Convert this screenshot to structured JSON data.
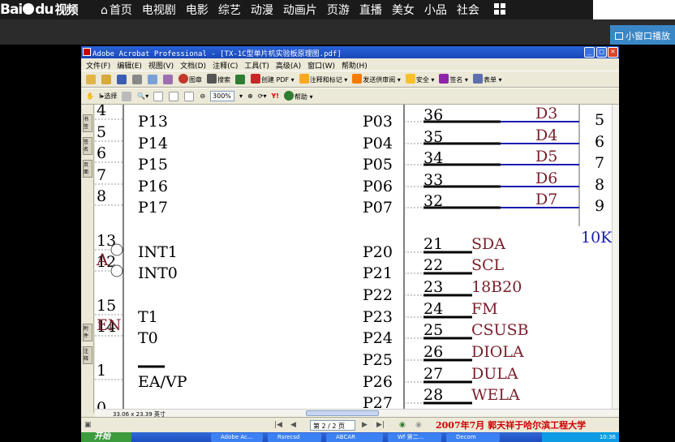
{
  "baidu": {
    "logo_text": "Bai",
    "logo_text2": "du",
    "logo_sub": "视频",
    "nav": [
      "首页",
      "电视剧",
      "电影",
      "综艺",
      "动漫",
      "动画片",
      "页游",
      "直播",
      "美女",
      "小品",
      "社会"
    ],
    "mini_play": "小窗口播放"
  },
  "acrobat": {
    "title": "Adobe Acrobat Professional - [TX-1C型单片机实验板原理图.pdf]",
    "menus": [
      "文件(F)",
      "编辑(E)",
      "视图(V)",
      "文档(D)",
      "注释(C)",
      "工具(T)",
      "高级(A)",
      "窗口(W)",
      "帮助(H)"
    ],
    "toolbar1": [
      "图章",
      "搜索",
      "创建 PDF",
      "注释和标记",
      "发送供审阅",
      "安全",
      "签名",
      "表单"
    ],
    "toolbar2": [
      "选择",
      "300%",
      "帮助"
    ],
    "side_tabs": [
      "书签",
      "签名",
      "页面",
      "附件",
      "注释"
    ],
    "page_size": "33.06 x 23.39 英寸",
    "page_indicator": "第 2 / 2 页",
    "signature": "2007年7月  郭天祥于哈尔滨工程大学"
  },
  "schematic": {
    "left_pins": [
      {
        "num": "4",
        "name": "P13"
      },
      {
        "num": "5",
        "name": "P14"
      },
      {
        "num": "6",
        "name": "P15"
      },
      {
        "num": "7",
        "name": "P16"
      },
      {
        "num": "8",
        "name": "P17"
      },
      {
        "num": "13",
        "name": "INT1"
      },
      {
        "num": "12",
        "name": "INT0"
      },
      {
        "num": "15",
        "name": "T1"
      },
      {
        "num": "14",
        "name": "T0"
      },
      {
        "num": "1",
        "name": "EA/VP"
      }
    ],
    "right_port_top": [
      "P03",
      "P04",
      "P05",
      "P06",
      "P07"
    ],
    "right_nums_top": [
      "36",
      "35",
      "34",
      "33",
      "32"
    ],
    "data_labels": [
      "D3",
      "D4",
      "D5",
      "D6",
      "D7"
    ],
    "far_right_nums": [
      "5",
      "6",
      "7",
      "8",
      "9"
    ],
    "resistor": "10K",
    "right_port_bottom": [
      "P20",
      "P21",
      "P22",
      "P23",
      "P24",
      "P25",
      "P26",
      "P27"
    ],
    "right_nums_bottom": [
      "21",
      "22",
      "23",
      "24",
      "25",
      "26",
      "27",
      "28"
    ],
    "net_labels": [
      "SDA",
      "SCL",
      "18B20",
      "FM",
      "CSUSB",
      "DIOLA",
      "DULA",
      "WELA"
    ],
    "overlay_letters": [
      "A",
      "EN"
    ],
    "bottom_partial": "0"
  },
  "taskbar": {
    "start": "开始",
    "items": [
      "Adobe Ac...",
      "Rsrecsd",
      "ABCAR",
      "Wf 第二...",
      "Decom"
    ],
    "clock": "10:36"
  },
  "colors": {
    "schematic_text": "#000000",
    "net_label": "#7a1f2b",
    "data_label": "#7a1f2b",
    "blue_wire": "#1b1bb0",
    "signature": "#cc0000"
  }
}
